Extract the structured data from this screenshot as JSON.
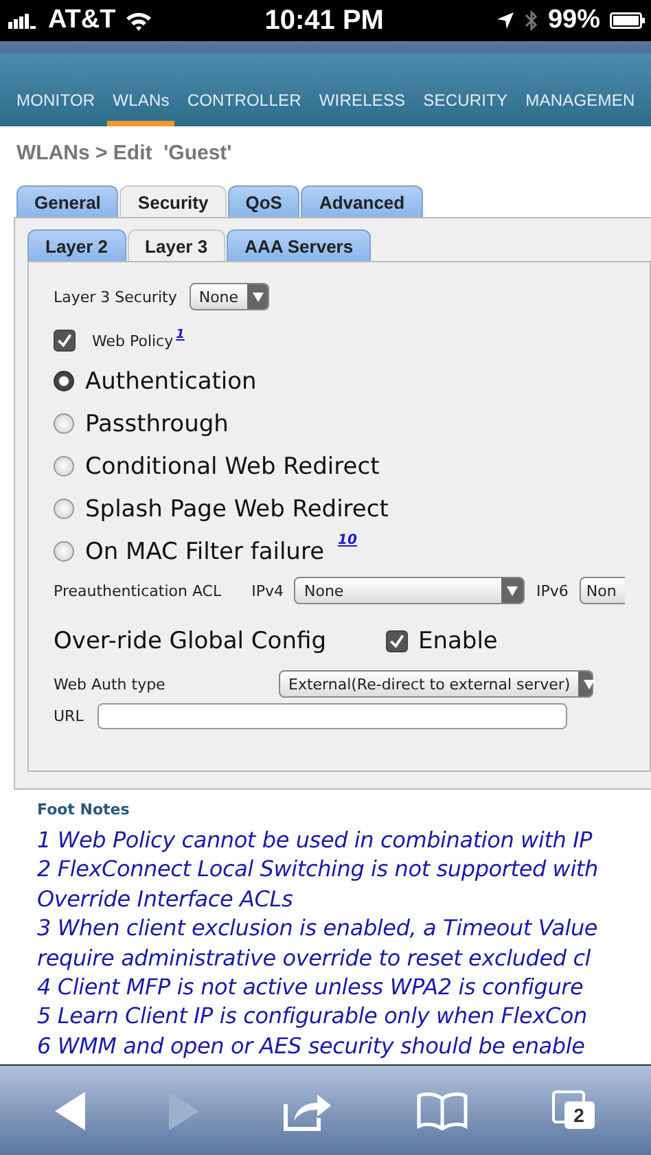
{
  "status_bar": {
    "carrier": "AT&T",
    "time": "10:41 PM",
    "battery": "99%"
  },
  "nav": [
    {
      "label": "MONITOR",
      "selected": false
    },
    {
      "label": "WLANs",
      "selected": true
    },
    {
      "label": "CONTROLLER",
      "selected": false
    },
    {
      "label": "WIRELESS",
      "selected": false
    },
    {
      "label": "SECURITY",
      "selected": false
    },
    {
      "label": "MANAGEMEN",
      "selected": false
    }
  ],
  "breadcrumb": "WLANs > Edit  'Guest'",
  "tabs": [
    {
      "label": "General",
      "selected": false
    },
    {
      "label": "Security",
      "selected": true
    },
    {
      "label": "QoS",
      "selected": false
    },
    {
      "label": "Advanced",
      "selected": false
    }
  ],
  "subtabs": [
    {
      "label": "Layer 2",
      "selected": false
    },
    {
      "label": "Layer 3",
      "selected": true
    },
    {
      "label": "AAA Servers",
      "selected": false
    }
  ],
  "layer3_security": {
    "label": "Layer 3 Security",
    "value": "None"
  },
  "web_policy": {
    "label": "Web Policy",
    "note": "1",
    "checked": true
  },
  "radios": [
    {
      "label": "Authentication",
      "selected": true
    },
    {
      "label": "Passthrough",
      "selected": false
    },
    {
      "label": "Conditional Web Redirect",
      "selected": false
    },
    {
      "label": "Splash Page Web Redirect",
      "selected": false
    },
    {
      "label": "On MAC Filter failure",
      "note": "10",
      "selected": false
    }
  ],
  "preauth_acl": {
    "label": "Preauthentication ACL",
    "ipv4_label": "IPv4",
    "ipv4_value": "None",
    "ipv6_label": "IPv6",
    "ipv6_value": "Non"
  },
  "override": {
    "label": "Over-ride Global Config",
    "checkbox_label": "Enable",
    "checked": true
  },
  "web_auth_type": {
    "label": "Web Auth type",
    "value": "External(Re-direct to external server)"
  },
  "url": {
    "label": "URL"
  },
  "foot_notes": {
    "title": "Foot Notes",
    "lines": [
      "1 Web Policy cannot be used in combination with IP",
      "2 FlexConnect Local Switching is not supported with",
      "Override Interface ACLs",
      "3 When client exclusion is enabled, a Timeout Value",
      "require administrative override to reset excluded cl",
      "4 Client MFP is not active unless WPA2 is configure",
      "5 Learn Client IP is configurable only when FlexCon",
      "6 WMM and open or AES security should be enable"
    ]
  },
  "toolbar": {
    "tabs_count": "2"
  }
}
